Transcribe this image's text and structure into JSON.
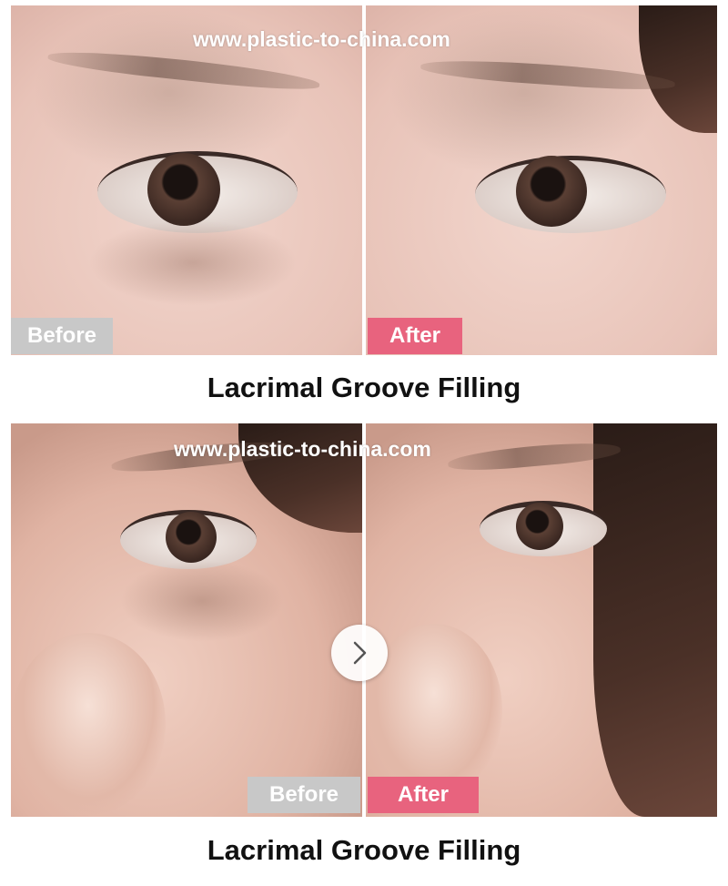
{
  "watermark_text": "www.plastic-to-china.com",
  "rows": [
    {
      "before_label": "Before",
      "after_label": "After",
      "caption": "Lacrimal Groove Filling"
    },
    {
      "before_label": "Before",
      "after_label": "After",
      "caption": "Lacrimal Groove Filling"
    }
  ],
  "colors": {
    "before_badge": "#c8c8c8",
    "after_badge": "#e8637e"
  },
  "next_button_icon": "chevron-right-icon"
}
